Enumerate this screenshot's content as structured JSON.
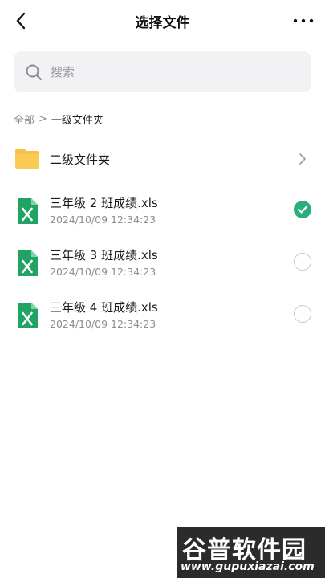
{
  "header": {
    "title": "选择文件",
    "back_icon": "chevron-left-icon",
    "more_icon": "more-horizontal-icon"
  },
  "search": {
    "placeholder": "搜索",
    "value": ""
  },
  "breadcrumb": {
    "root": "全部",
    "separator": ">",
    "current": "一级文件夹"
  },
  "folders": [
    {
      "name": "二级文件夹",
      "icon": "folder-icon"
    }
  ],
  "files": [
    {
      "name": "三年级 2 班成绩.xls",
      "time": "2024/10/09 12:34:23",
      "selected": true,
      "icon": "excel-file-icon"
    },
    {
      "name": "三年级 3 班成绩.xls",
      "time": "2024/10/09 12:34:23",
      "selected": false,
      "icon": "excel-file-icon"
    },
    {
      "name": "三年级 4 班成绩.xls",
      "time": "2024/10/09 12:34:23",
      "selected": false,
      "icon": "excel-file-icon"
    }
  ],
  "colors": {
    "accent": "#2aae7a",
    "folder": "#f7c04a",
    "excel": "#21a366",
    "search_bg": "#f2f2f4"
  },
  "watermark": {
    "title": "谷普软件园",
    "url": "www.gupuxiazai.com"
  }
}
